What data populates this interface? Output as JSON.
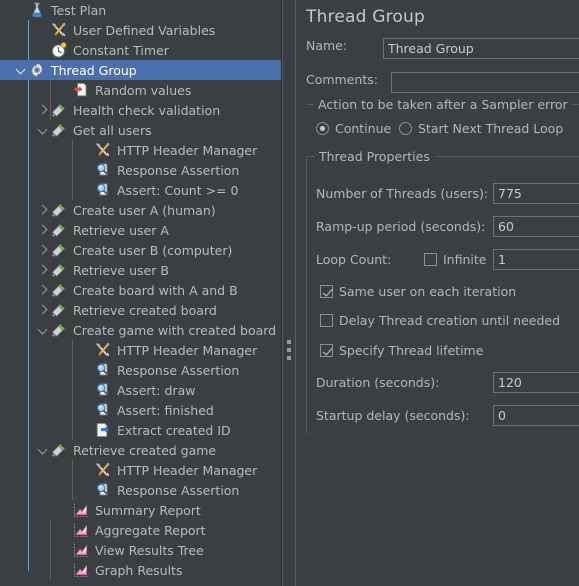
{
  "tree": {
    "items": [
      {
        "label": "Test Plan",
        "depth": 0,
        "icon": "test-plan-icon",
        "toggle": "none",
        "selected": false
      },
      {
        "label": "User Defined Variables",
        "depth": 1,
        "icon": "config-element-icon",
        "toggle": "none",
        "selected": false
      },
      {
        "label": "Constant Timer",
        "depth": 1,
        "icon": "timer-icon",
        "toggle": "none",
        "selected": false
      },
      {
        "label": "Thread Group",
        "depth": 0,
        "icon": "thread-group-icon",
        "toggle": "expanded",
        "selected": true
      },
      {
        "label": "Random values",
        "depth": 2,
        "icon": "csv-data-set-icon",
        "toggle": "none",
        "selected": false
      },
      {
        "label": "Health check validation",
        "depth": 1,
        "icon": "sampler-icon",
        "toggle": "collapsed",
        "selected": false
      },
      {
        "label": "Get all users",
        "depth": 1,
        "icon": "sampler-icon",
        "toggle": "expanded",
        "selected": false
      },
      {
        "label": "HTTP Header Manager",
        "depth": 3,
        "icon": "config-element-icon",
        "toggle": "none",
        "selected": false
      },
      {
        "label": "Response Assertion",
        "depth": 3,
        "icon": "assertion-icon",
        "toggle": "none",
        "selected": false
      },
      {
        "label": "Assert: Count >= 0",
        "depth": 3,
        "icon": "assertion-icon",
        "toggle": "none",
        "selected": false
      },
      {
        "label": "Create user A (human)",
        "depth": 1,
        "icon": "sampler-icon",
        "toggle": "collapsed",
        "selected": false
      },
      {
        "label": "Retrieve user A",
        "depth": 1,
        "icon": "sampler-icon",
        "toggle": "collapsed",
        "selected": false
      },
      {
        "label": "Create user B (computer)",
        "depth": 1,
        "icon": "sampler-icon",
        "toggle": "collapsed",
        "selected": false
      },
      {
        "label": "Retrieve user B",
        "depth": 1,
        "icon": "sampler-icon",
        "toggle": "collapsed",
        "selected": false
      },
      {
        "label": "Create board with A and B",
        "depth": 1,
        "icon": "sampler-icon",
        "toggle": "collapsed",
        "selected": false
      },
      {
        "label": "Retrieve created board",
        "depth": 1,
        "icon": "sampler-icon",
        "toggle": "collapsed",
        "selected": false
      },
      {
        "label": "Create game with created board",
        "depth": 1,
        "icon": "sampler-icon",
        "toggle": "expanded",
        "selected": false
      },
      {
        "label": "HTTP Header Manager",
        "depth": 3,
        "icon": "config-element-icon",
        "toggle": "none",
        "selected": false
      },
      {
        "label": "Response Assertion",
        "depth": 3,
        "icon": "assertion-icon",
        "toggle": "none",
        "selected": false
      },
      {
        "label": "Assert: draw",
        "depth": 3,
        "icon": "assertion-icon",
        "toggle": "none",
        "selected": false
      },
      {
        "label": "Assert: finished",
        "depth": 3,
        "icon": "assertion-icon",
        "toggle": "none",
        "selected": false
      },
      {
        "label": "Extract created ID",
        "depth": 3,
        "icon": "post-processor-icon",
        "toggle": "none",
        "selected": false
      },
      {
        "label": "Retrieve created game",
        "depth": 1,
        "icon": "sampler-icon",
        "toggle": "expanded",
        "selected": false
      },
      {
        "label": "HTTP Header Manager",
        "depth": 3,
        "icon": "config-element-icon",
        "toggle": "none",
        "selected": false
      },
      {
        "label": "Response Assertion",
        "depth": 3,
        "icon": "assertion-icon",
        "toggle": "none",
        "selected": false
      },
      {
        "label": "Summary Report",
        "depth": 2,
        "icon": "listener-icon",
        "toggle": "none",
        "selected": false
      },
      {
        "label": "Aggregate Report",
        "depth": 2,
        "icon": "listener-icon",
        "toggle": "none",
        "selected": false
      },
      {
        "label": "View Results Tree",
        "depth": 2,
        "icon": "listener-icon",
        "toggle": "none",
        "selected": false
      },
      {
        "label": "Graph Results",
        "depth": 2,
        "icon": "listener-icon",
        "toggle": "none",
        "selected": false
      }
    ]
  },
  "panel": {
    "title": "Thread Group",
    "name_label": "Name:",
    "name_value": "Thread Group",
    "comments_label": "Comments:",
    "comments_value": "",
    "sampler_error_group_title": "Action to be taken after a Sampler error",
    "sampler_error_options": [
      {
        "label": "Continue",
        "selected": true
      },
      {
        "label": "Start Next Thread Loop",
        "selected": false
      }
    ],
    "thread_properties_group_title": "Thread Properties",
    "num_threads_label": "Number of Threads (users):",
    "num_threads_value": "775",
    "ramp_up_label": "Ramp-up period (seconds):",
    "ramp_up_value": "60",
    "loop_count_label": "Loop Count:",
    "infinite_label": "Infinite",
    "infinite_checked": false,
    "loop_count_value": "1",
    "same_user_label": "Same user on each iteration",
    "same_user_checked": true,
    "delay_thread_label": "Delay Thread creation until needed",
    "delay_thread_checked": false,
    "specify_lifetime_label": "Specify Thread lifetime",
    "specify_lifetime_checked": true,
    "duration_label": "Duration (seconds):",
    "duration_value": "120",
    "startup_delay_label": "Startup delay (seconds):",
    "startup_delay_value": "0"
  },
  "colors": {
    "panel_bg": "#3c3f41",
    "selection_blue": "#4a6fab",
    "text": "#b6b6b6",
    "border": "#6e7275",
    "guide_line": "#5c6063",
    "guide_line_root": "#6f9ec9"
  }
}
